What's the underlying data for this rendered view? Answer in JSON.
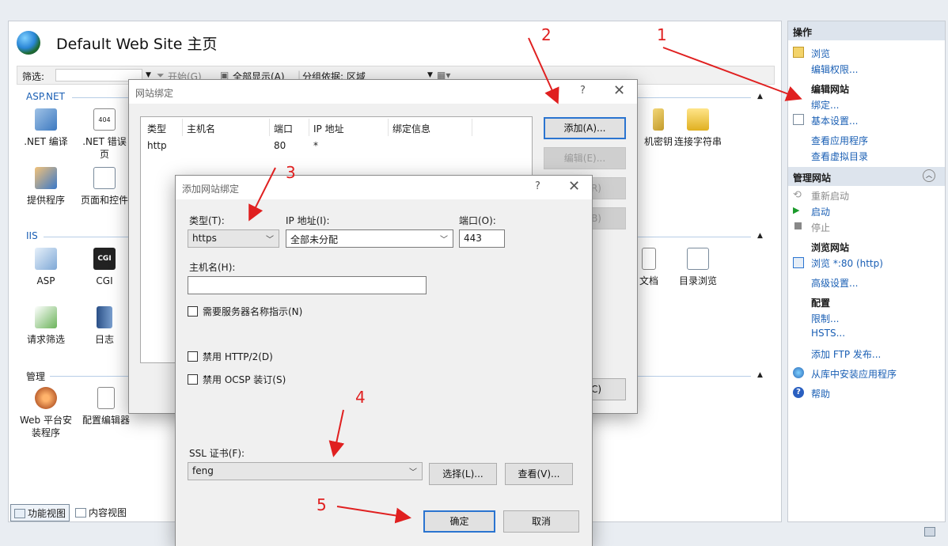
{
  "page": {
    "title": "Default Web Site 主页",
    "filter": {
      "label": "筛选:",
      "start": "开始(G)",
      "show_all": "全部显示(A)",
      "group_by_label": "分组依据:",
      "group_by_value": "区域"
    },
    "sections": {
      "aspnet": "ASP.NET",
      "iis": "IIS",
      "manage": "管理"
    },
    "features": {
      "aspnet": [
        ".NET 编译",
        ".NET 错误页",
        "机密钥",
        "连接字符串",
        "提供程序",
        "页面和控件"
      ],
      "iis": [
        "ASP",
        "CGI",
        "文档",
        "目录浏览",
        "请求筛选",
        "日志"
      ],
      "manage": [
        "Web 平台安装程序",
        "配置编辑器"
      ]
    },
    "bottom_tabs": {
      "features_view": "功能视图",
      "content_view": "内容视图"
    }
  },
  "actions": {
    "header": "操作",
    "browse": "浏览",
    "edit_permissions": "编辑权限...",
    "edit_site_header": "编辑网站",
    "bindings": "绑定...",
    "basic_settings": "基本设置...",
    "view_apps": "查看应用程序",
    "view_vdirs": "查看虚拟目录",
    "manage_site_header": "管理网站",
    "restart": "重新启动",
    "start": "启动",
    "stop": "停止",
    "browse_site_header": "浏览网站",
    "browse_port": "浏览 *:80 (http)",
    "advanced_settings": "高级设置...",
    "config_header": "配置",
    "limits": "限制...",
    "hsts": "HSTS...",
    "add_ftp": "添加 FTP 发布...",
    "install_from_gallery": "从库中安装应用程序",
    "help": "帮助"
  },
  "bindings_dialog": {
    "title": "网站绑定",
    "help_mark": "?",
    "close_mark": "✕",
    "columns": [
      "类型",
      "主机名",
      "端口",
      "IP 地址",
      "绑定信息"
    ],
    "rows": [
      [
        "http",
        "",
        "80",
        "*",
        ""
      ]
    ],
    "add": "添加(A)...",
    "edit": "编辑(E)...",
    "remove_tail": "R)",
    "browse_tail": "B)",
    "close_tail": "C)"
  },
  "add_binding_dialog": {
    "title": "添加网站绑定",
    "help_mark": "?",
    "close_mark": "✕",
    "type_label": "类型(T):",
    "type_value": "https",
    "ip_label": "IP 地址(I):",
    "ip_value": "全部未分配",
    "port_label": "端口(O):",
    "port_value": "443",
    "hostname_label": "主机名(H):",
    "hostname_value": "",
    "sni_label": "需要服务器名称指示(N)",
    "disable_http2_label": "禁用 HTTP/2(D)",
    "disable_ocsp_label": "禁用 OCSP 装订(S)",
    "ssl_label": "SSL 证书(F):",
    "ssl_value": "feng",
    "select_btn": "选择(L)...",
    "view_btn": "查看(V)...",
    "ok": "确定",
    "cancel": "取消"
  },
  "annotations": [
    "1",
    "2",
    "3",
    "4",
    "5"
  ],
  "colors": {
    "annotation": "#e02020",
    "link": "#1a5fb4",
    "primary_border": "#2a74d0"
  }
}
